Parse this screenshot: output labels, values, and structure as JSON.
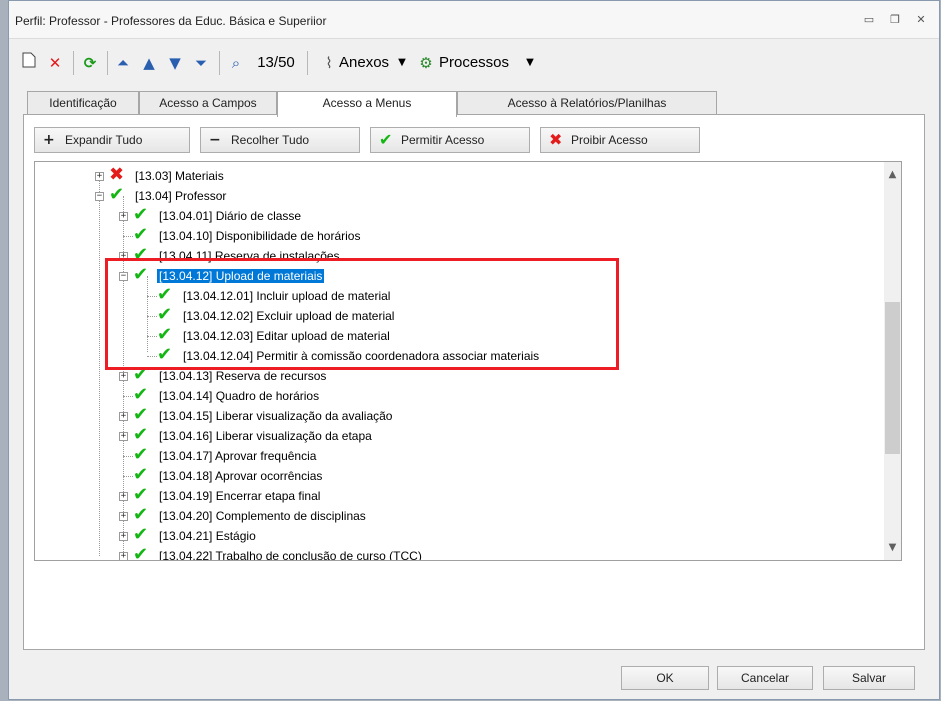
{
  "window": {
    "title": "Perfil: Professor - Professores da Educ. Básica  e Superiior",
    "controls": {
      "minimize": "▭",
      "restore": "❐",
      "close": "✕"
    }
  },
  "toolbar": {
    "counter": "13/50",
    "anexos_label": "Anexos",
    "processos_label": "Processos",
    "icons": [
      "new-icon",
      "delete-icon",
      "refresh-icon",
      "first-icon",
      "previous-icon",
      "next-icon",
      "last-icon",
      "find-icon",
      "attach-icon",
      "process-icon"
    ]
  },
  "tabs": [
    {
      "label": "Identificação"
    },
    {
      "label": "Acesso a Campos"
    },
    {
      "label": "Acesso a Menus"
    },
    {
      "label": "Acesso à Relatórios/Planilhas"
    }
  ],
  "actions": {
    "expandir": "Expandir Tudo",
    "recolher": "Recolher Tudo",
    "permitir": "Permitir Acesso",
    "proibir": "Proibir Acesso"
  },
  "tree": {
    "items": [
      {
        "label": "[13.03] Materiais",
        "status": "denied"
      },
      {
        "label": "[13.04] Professor",
        "status": "allowed"
      },
      {
        "label": "[13.04.01] Diário de classe",
        "status": "allowed"
      },
      {
        "label": "[13.04.10] Disponibilidade de horários",
        "status": "allowed"
      },
      {
        "label": "[13.04.11] Reserva de instalações",
        "status": "allowed"
      },
      {
        "label": "[13.04.12] Upload de materiais",
        "status": "allowed",
        "selected": true
      },
      {
        "label": "[13.04.12.01] Incluir upload de material",
        "status": "allowed"
      },
      {
        "label": "[13.04.12.02] Excluir upload de material",
        "status": "allowed"
      },
      {
        "label": "[13.04.12.03] Editar upload de material",
        "status": "allowed"
      },
      {
        "label": "[13.04.12.04] Permitir à comissão coordenadora associar materiais",
        "status": "allowed"
      },
      {
        "label": "[13.04.13] Reserva de recursos",
        "status": "allowed"
      },
      {
        "label": "[13.04.14] Quadro de horários",
        "status": "allowed"
      },
      {
        "label": "[13.04.15] Liberar visualização da avaliação",
        "status": "allowed"
      },
      {
        "label": "[13.04.16] Liberar visualização da etapa",
        "status": "allowed"
      },
      {
        "label": "[13.04.17] Aprovar frequência",
        "status": "allowed"
      },
      {
        "label": "[13.04.18] Aprovar ocorrências",
        "status": "allowed"
      },
      {
        "label": "[13.04.19] Encerrar etapa final",
        "status": "allowed"
      },
      {
        "label": "[13.04.20] Complemento de disciplinas",
        "status": "allowed"
      },
      {
        "label": "[13.04.21] Estágio",
        "status": "allowed"
      },
      {
        "label": "[13.04.22] Trabalho de conclusão de curso (TCC)",
        "status": "allowed"
      }
    ]
  },
  "footer": {
    "ok": "OK",
    "cancelar": "Cancelar",
    "salvar": "Salvar"
  },
  "colors": {
    "selection": "#0078d7",
    "highlight_box": "#ee1c25",
    "check_green": "#13b613",
    "deny_red": "#e31b1b"
  }
}
